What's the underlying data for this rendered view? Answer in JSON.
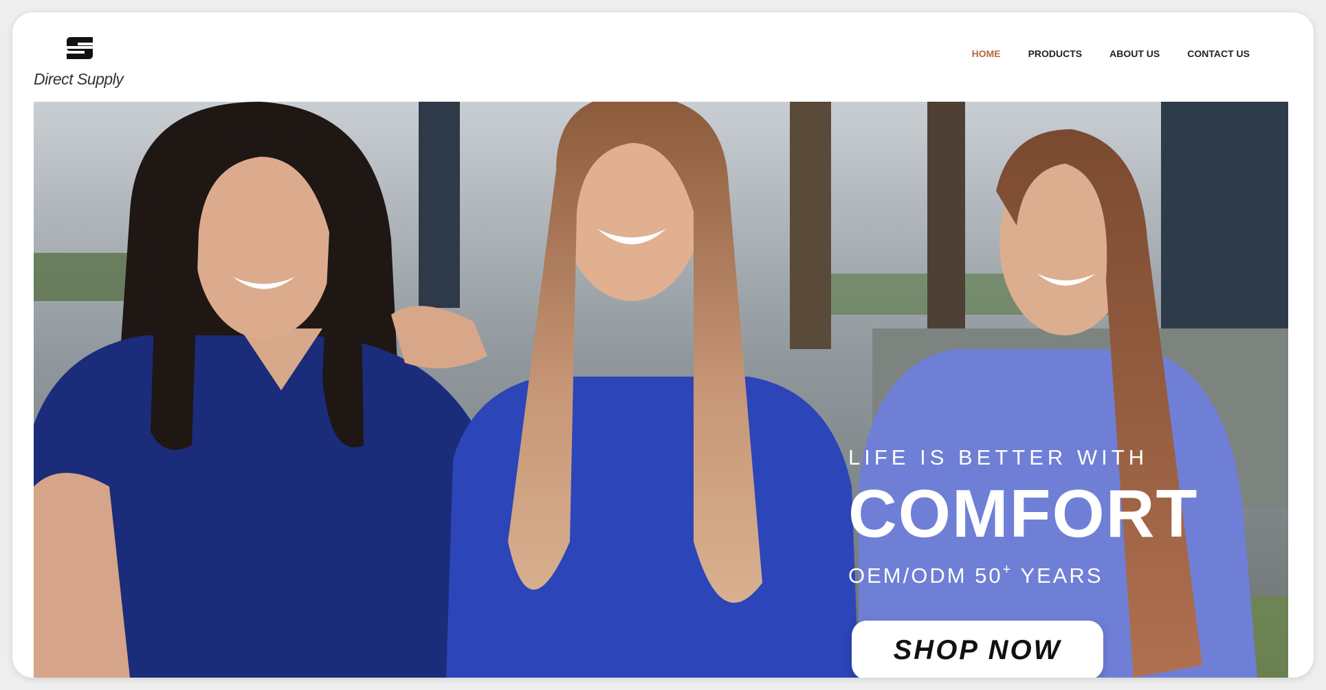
{
  "brand": {
    "name": "Direct Supply",
    "logo_icon": "ds-monogram-icon"
  },
  "nav": {
    "items": [
      {
        "label": "HOME",
        "active": true
      },
      {
        "label": "PRODUCTS",
        "active": false
      },
      {
        "label": "ABOUT US",
        "active": false
      },
      {
        "label": "CONTACT US",
        "active": false
      }
    ],
    "active_color": "#b8673f",
    "text_color": "#222222"
  },
  "hero": {
    "tagline": "LIFE IS BETTER WITH",
    "headline": "COMFORT",
    "subline_prefix": "OEM/ODM 50",
    "subline_sup": "+",
    "subline_suffix": " YEARS",
    "cta_label": "SHOP NOW",
    "photo_subject": "three smiling women wearing blue medical scrubs outdoors"
  }
}
